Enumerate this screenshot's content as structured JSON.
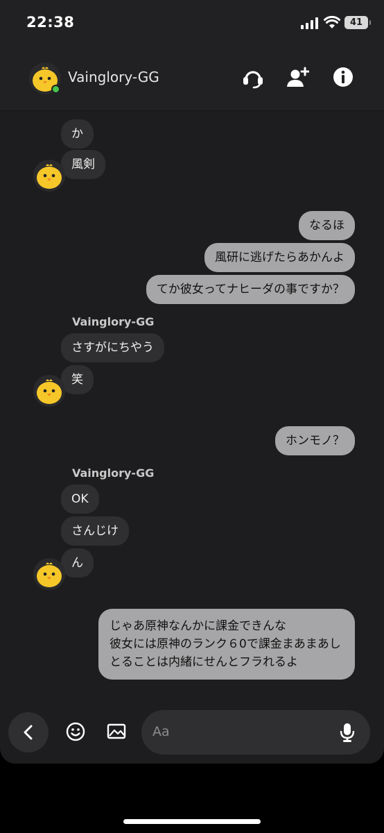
{
  "status_bar": {
    "time": "22:38",
    "battery": "41"
  },
  "header": {
    "contact_name": "Vainglory-GG",
    "icons": [
      "call-icon",
      "add-person-icon",
      "info-icon"
    ]
  },
  "messages": [
    {
      "side": "in",
      "text": "か"
    },
    {
      "side": "in",
      "text": "風剣"
    },
    {
      "side": "out",
      "text": "なるほ"
    },
    {
      "side": "out",
      "text": "風研に逃げたらあかんよ"
    },
    {
      "side": "out",
      "text": "てか彼女ってナヒーダの事ですか？"
    },
    {
      "side": "in",
      "sender": "Vainglory-GG",
      "text": "さすがにちやう"
    },
    {
      "side": "in",
      "text": "笑"
    },
    {
      "side": "out",
      "text": "ホンモノ？"
    },
    {
      "side": "in",
      "sender": "Vainglory-GG",
      "text": "OK"
    },
    {
      "side": "in",
      "text": "さんじけ"
    },
    {
      "side": "in",
      "text": "ん"
    },
    {
      "side": "out",
      "text": "じゃあ原神なんかに課金できんな\n彼女には原神のランク６0で課金まあまあしとることは内緒にせんとフラれるよ"
    }
  ],
  "composer": {
    "placeholder": "Aa"
  },
  "colors": {
    "background": "#1d1d1f",
    "incoming_bubble": "#2f2f31",
    "outgoing_bubble": "#a6a6a8",
    "online": "#45c44c"
  }
}
